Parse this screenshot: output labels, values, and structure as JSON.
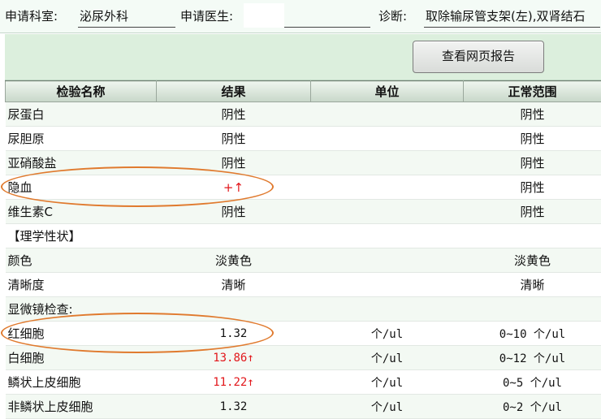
{
  "header": {
    "dept_label": "申请科室:",
    "dept_value": "泌尿外科",
    "doctor_label": "申请医生:",
    "doctor_value": "",
    "diagnosis_label": "诊断:",
    "diagnosis_value": "取除输尿管支架(左),双肾结石"
  },
  "toolbar": {
    "report_button": "查看网页报告"
  },
  "table": {
    "columns": [
      "检验名称",
      "结果",
      "单位",
      "正常范围"
    ],
    "rows": [
      {
        "name": "尿蛋白",
        "result": "阴性",
        "unit": "",
        "range": "阴性"
      },
      {
        "name": "尿胆原",
        "result": "阴性",
        "unit": "",
        "range": "阴性"
      },
      {
        "name": "亚硝酸盐",
        "result": "阴性",
        "unit": "",
        "range": "阴性"
      },
      {
        "name": "隐血",
        "result": "+↑",
        "unit": "",
        "range": "阴性"
      },
      {
        "name": "维生素C",
        "result": "阴性",
        "unit": "",
        "range": "阴性"
      },
      {
        "name": "【理学性状】",
        "result": "",
        "unit": "",
        "range": ""
      },
      {
        "name": "颜色",
        "result": "淡黄色",
        "unit": "",
        "range": "淡黄色"
      },
      {
        "name": "清晰度",
        "result": "清晰",
        "unit": "",
        "range": "清晰"
      },
      {
        "name": "显微镜检查:",
        "result": "",
        "unit": "",
        "range": ""
      },
      {
        "name": "红细胞",
        "result": "1.32",
        "unit": "个/ul",
        "range": "0~10 个/ul"
      },
      {
        "name": "白细胞",
        "result": "13.86↑",
        "unit": "个/ul",
        "range": "0~12 个/ul"
      },
      {
        "name": "鳞状上皮细胞",
        "result": "11.22↑",
        "unit": "个/ul",
        "range": "0~5 个/ul"
      },
      {
        "name": "非鳞状上皮细胞",
        "result": "1.32",
        "unit": "个/ul",
        "range": "0~2 个/ul"
      }
    ]
  },
  "colors": {
    "abnormal": "#e2171b",
    "annotation": "#e07a2e"
  }
}
